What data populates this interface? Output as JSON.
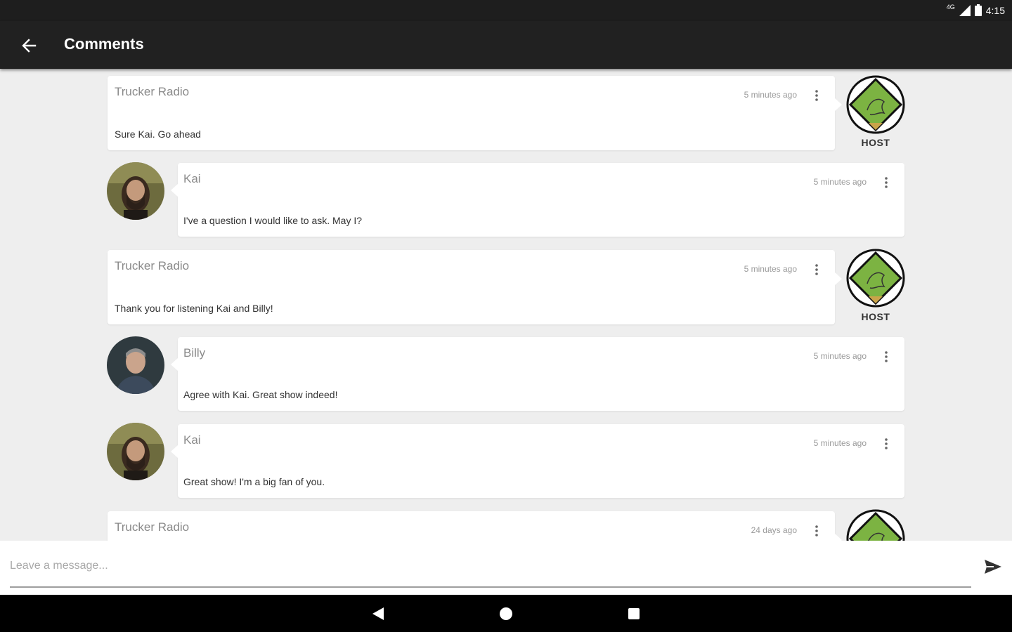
{
  "status_bar": {
    "network": "4G",
    "time": "4:15"
  },
  "app_bar": {
    "title": "Comments",
    "back_icon": "arrow-left-icon"
  },
  "comments": [
    {
      "author": "Trucker Radio",
      "time": "5 minutes ago",
      "message": "Sure Kai. Go ahead",
      "role": "host",
      "badge": "HOST"
    },
    {
      "author": "Kai",
      "time": "5 minutes ago",
      "message": "I've a question I would like to ask. May I?",
      "role": "user"
    },
    {
      "author": "Trucker Radio",
      "time": "5 minutes ago",
      "message": "Thank you for listening Kai and Billy!",
      "role": "host",
      "badge": "HOST"
    },
    {
      "author": "Billy",
      "time": "5 minutes ago",
      "message": "Agree with Kai. Great show indeed!",
      "role": "user"
    },
    {
      "author": "Kai",
      "time": "5 minutes ago",
      "message": "Great show! I'm a big fan of you.",
      "role": "user"
    },
    {
      "author": "Trucker Radio",
      "time": "24 days ago",
      "message": "",
      "role": "host"
    }
  ],
  "composer": {
    "placeholder": "Leave a message...",
    "send_icon": "send-icon"
  },
  "nav": {
    "back_icon": "nav-back-icon",
    "home_icon": "nav-home-icon",
    "recents_icon": "nav-recents-icon"
  },
  "colors": {
    "app_bar": "#212121",
    "status_bar": "#1e1e1e",
    "background": "#eeeeee",
    "host_logo_green": "#7cb342"
  }
}
